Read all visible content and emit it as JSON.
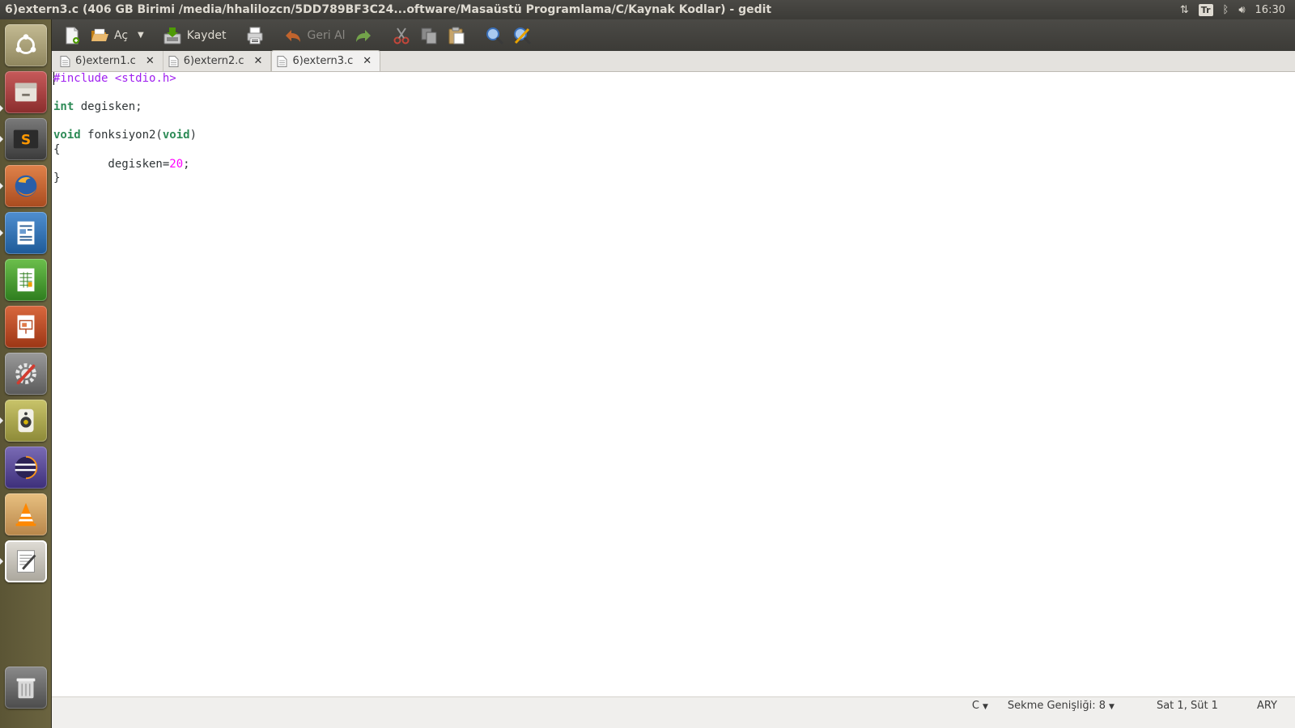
{
  "panel": {
    "window_title": "6)extern3.c (406 GB Birimi /media/hhalilozcn/5DD789BF3C24...oftware/Masaüstü Programlama/C/Kaynak Kodlar) - gedit",
    "keyboard_layout": "Tr",
    "clock": "16:30"
  },
  "launcher": {
    "items": [
      "ubuntu-dash",
      "files",
      "sublime-text",
      "firefox",
      "libreoffice-writer",
      "libreoffice-calc",
      "libreoffice-impress",
      "system-settings",
      "rhythmbox",
      "eclipse",
      "vlc",
      "gedit",
      "trash"
    ]
  },
  "toolbar": {
    "open_label": "Aç",
    "save_label": "Kaydet",
    "undo_label": "Geri Al"
  },
  "tabs": [
    {
      "label": "6)extern1.c"
    },
    {
      "label": "6)extern2.c"
    },
    {
      "label": "6)extern3.c",
      "active": true
    }
  ],
  "editor": {
    "lines": [
      "#include <stdio.h>",
      "",
      "int degisken;",
      "",
      "void fonksiyon2(void)",
      "{",
      "\tdegisken=20;",
      "}"
    ],
    "tokens": {
      "include": "#include",
      "header": " <stdio.h>",
      "int_kw": "int",
      "var_decl": " degisken;",
      "void_kw": "void",
      "func_name": " fonksiyon2(",
      "void_param": "void",
      "paren_close": ")",
      "brace_open": "{",
      "assign_indent": "        degisken=",
      "number": "20",
      "semicolon": ";",
      "brace_close": "}"
    },
    "colors": {
      "preprocessor": "#a020f0",
      "keyword": "#2e8b57",
      "number": "#ff00ff"
    }
  },
  "statusbar": {
    "language": "C",
    "tab_width": "Sekme Genişliği: 8",
    "position": "Sat 1, Süt 1",
    "mode": "ARY"
  }
}
